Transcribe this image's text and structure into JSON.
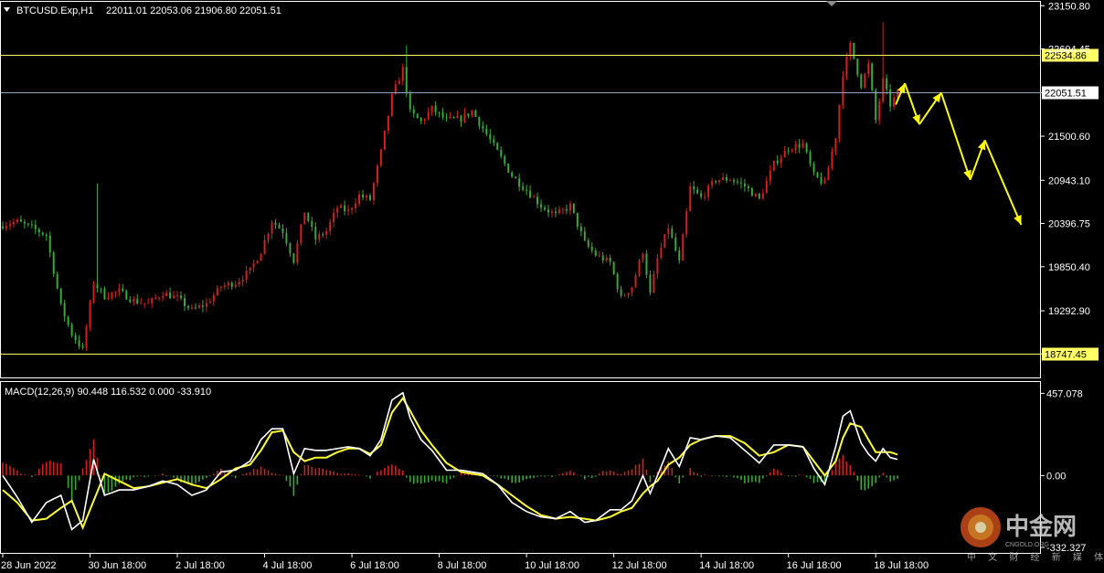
{
  "chart_header": {
    "symbol_text": "BTCUSD.Exp,H1",
    "ohlc_text": "22011.01 22053.06 21906.80 22051.51"
  },
  "macd_header": {
    "text": "MACD(12,26,9) 90.448 116.532 0.000 -33.910"
  },
  "watermark": {
    "brand": "中金网",
    "sub": "CNGOLD.ORG",
    "tagline": "中 文 财 经 新 媒 体"
  },
  "colors": {
    "background": "#000000",
    "frame": "#ffffff",
    "bull": "#d02020",
    "bear": "#3aa83a",
    "level_line": "#ffff66",
    "price_line": "#8fa3b8",
    "macd_line": "#ffffff",
    "signal_line": "#ffff33",
    "forecast": "#ffff00"
  },
  "chart_data": {
    "type": "candlestick",
    "price_axis": {
      "ylim": [
        18450,
        23200
      ],
      "ticks": [
        23150.8,
        22604.45,
        22051.51,
        21500.6,
        20943.1,
        20396.75,
        19850.4,
        19292.9,
        18747.45
      ],
      "tick_labels": [
        "23150.80",
        "22604.45",
        "22051.51",
        "21500.60",
        "20943.10",
        "20396.75",
        "19850.40",
        "19292.90",
        "18747.45"
      ],
      "tick_label_hidden": [
        "22604.45",
        "22051.51",
        "18747.45"
      ]
    },
    "x_axis": {
      "labels": [
        "28 Jun 2022",
        "30 Jun 18:00",
        "2 Jul 18:00",
        "4 Jul 18:00",
        "6 Jul 18:00",
        "8 Jul 18:00",
        "10 Jul 18:00",
        "12 Jul 18:00",
        "14 Jul 18:00",
        "16 Jul 18:00",
        "18 Jul 18:00"
      ],
      "label_bar_index": [
        0,
        24,
        48,
        72,
        96,
        120,
        144,
        168,
        192,
        216,
        240
      ]
    },
    "horizontal_levels": [
      {
        "value": 22534.86,
        "label": "22534.86",
        "kind": "level"
      },
      {
        "value": 22051.51,
        "label": "22051.51",
        "kind": "current"
      },
      {
        "value": 18747.45,
        "label": "18747.45",
        "kind": "level"
      }
    ],
    "close_path": [
      [
        0,
        20380
      ],
      [
        4,
        20420
      ],
      [
        8,
        20340
      ],
      [
        12,
        20250
      ],
      [
        16,
        19350
      ],
      [
        19,
        19000
      ],
      [
        22,
        18800
      ],
      [
        25,
        19650
      ],
      [
        28,
        19480
      ],
      [
        32,
        19540
      ],
      [
        36,
        19420
      ],
      [
        40,
        19380
      ],
      [
        44,
        19520
      ],
      [
        48,
        19450
      ],
      [
        52,
        19300
      ],
      [
        56,
        19380
      ],
      [
        60,
        19600
      ],
      [
        64,
        19650
      ],
      [
        68,
        19800
      ],
      [
        71,
        20050
      ],
      [
        74,
        20430
      ],
      [
        77,
        20300
      ],
      [
        80,
        19930
      ],
      [
        83,
        20550
      ],
      [
        86,
        20200
      ],
      [
        89,
        20300
      ],
      [
        92,
        20600
      ],
      [
        95,
        20550
      ],
      [
        98,
        20750
      ],
      [
        101,
        20700
      ],
      [
        104,
        21300
      ],
      [
        107,
        22000
      ],
      [
        110,
        22350
      ],
      [
        112,
        21800
      ],
      [
        115,
        21680
      ],
      [
        118,
        21850
      ],
      [
        122,
        21700
      ],
      [
        126,
        21720
      ],
      [
        129,
        21820
      ],
      [
        132,
        21600
      ],
      [
        136,
        21300
      ],
      [
        140,
        21000
      ],
      [
        144,
        20820
      ],
      [
        148,
        20620
      ],
      [
        152,
        20500
      ],
      [
        156,
        20620
      ],
      [
        160,
        20150
      ],
      [
        163,
        20000
      ],
      [
        167,
        19900
      ],
      [
        170,
        19450
      ],
      [
        173,
        19600
      ],
      [
        176,
        20050
      ],
      [
        178,
        19500
      ],
      [
        180,
        19950
      ],
      [
        183,
        20350
      ],
      [
        186,
        19900
      ],
      [
        189,
        20850
      ],
      [
        192,
        20720
      ],
      [
        196,
        20950
      ],
      [
        200,
        20960
      ],
      [
        204,
        20870
      ],
      [
        208,
        20700
      ],
      [
        212,
        21150
      ],
      [
        216,
        21350
      ],
      [
        220,
        21400
      ],
      [
        223,
        21000
      ],
      [
        226,
        20900
      ],
      [
        229,
        21500
      ],
      [
        231,
        22300
      ],
      [
        233,
        22650
      ],
      [
        236,
        22150
      ],
      [
        238,
        22400
      ],
      [
        240,
        21700
      ],
      [
        242,
        22200
      ],
      [
        244,
        21900
      ],
      [
        246,
        22051.51
      ]
    ],
    "bar_count": 247,
    "price_range": {
      "high": 22940,
      "low": 18800
    },
    "forecast_path": [
      [
        245.5,
        21900
      ],
      [
        248,
        22170
      ],
      [
        252,
        21650
      ],
      [
        258,
        22050
      ],
      [
        266,
        20950
      ],
      [
        270,
        21450
      ],
      [
        280,
        20380
      ]
    ],
    "macd": {
      "ylim": [
        -430,
        520
      ],
      "ticks": [
        457.078,
        0.0,
        -332.327
      ],
      "tick_labels": [
        "457.078",
        "0.00",
        "-332.327"
      ],
      "macd_path": [
        [
          0,
          0
        ],
        [
          4,
          -120
        ],
        [
          8,
          -260
        ],
        [
          12,
          -150
        ],
        [
          16,
          -110
        ],
        [
          19,
          -300
        ],
        [
          22,
          -250
        ],
        [
          25,
          90
        ],
        [
          28,
          -110
        ],
        [
          32,
          -80
        ],
        [
          36,
          -80
        ],
        [
          40,
          -60
        ],
        [
          44,
          -30
        ],
        [
          48,
          -50
        ],
        [
          52,
          -110
        ],
        [
          56,
          -80
        ],
        [
          60,
          20
        ],
        [
          64,
          30
        ],
        [
          68,
          80
        ],
        [
          71,
          200
        ],
        [
          74,
          260
        ],
        [
          77,
          260
        ],
        [
          80,
          10
        ],
        [
          83,
          150
        ],
        [
          86,
          140
        ],
        [
          89,
          140
        ],
        [
          92,
          150
        ],
        [
          95,
          160
        ],
        [
          98,
          150
        ],
        [
          101,
          110
        ],
        [
          104,
          200
        ],
        [
          107,
          420
        ],
        [
          110,
          460
        ],
        [
          112,
          320
        ],
        [
          115,
          200
        ],
        [
          118,
          140
        ],
        [
          122,
          30
        ],
        [
          126,
          30
        ],
        [
          129,
          20
        ],
        [
          132,
          10
        ],
        [
          136,
          -50
        ],
        [
          140,
          -150
        ],
        [
          144,
          -200
        ],
        [
          148,
          -230
        ],
        [
          152,
          -240
        ],
        [
          156,
          -200
        ],
        [
          160,
          -260
        ],
        [
          163,
          -250
        ],
        [
          167,
          -190
        ],
        [
          170,
          -190
        ],
        [
          173,
          -140
        ],
        [
          176,
          0
        ],
        [
          178,
          -100
        ],
        [
          180,
          0
        ],
        [
          183,
          150
        ],
        [
          186,
          50
        ],
        [
          189,
          210
        ],
        [
          192,
          200
        ],
        [
          196,
          220
        ],
        [
          200,
          210
        ],
        [
          204,
          140
        ],
        [
          208,
          70
        ],
        [
          212,
          170
        ],
        [
          216,
          170
        ],
        [
          220,
          160
        ],
        [
          223,
          40
        ],
        [
          226,
          -50
        ],
        [
          229,
          160
        ],
        [
          231,
          330
        ],
        [
          233,
          360
        ],
        [
          236,
          180
        ],
        [
          238,
          120
        ],
        [
          240,
          80
        ],
        [
          242,
          150
        ],
        [
          244,
          100
        ],
        [
          246,
          90
        ]
      ],
      "signal_path": [
        [
          0,
          -80
        ],
        [
          4,
          -150
        ],
        [
          8,
          -250
        ],
        [
          12,
          -240
        ],
        [
          16,
          -180
        ],
        [
          19,
          -140
        ],
        [
          22,
          -290
        ],
        [
          25,
          -140
        ],
        [
          28,
          10
        ],
        [
          32,
          -30
        ],
        [
          36,
          -70
        ],
        [
          40,
          -60
        ],
        [
          44,
          -40
        ],
        [
          48,
          -20
        ],
        [
          52,
          -50
        ],
        [
          56,
          -70
        ],
        [
          60,
          -20
        ],
        [
          64,
          40
        ],
        [
          68,
          60
        ],
        [
          71,
          140
        ],
        [
          74,
          240
        ],
        [
          77,
          250
        ],
        [
          80,
          130
        ],
        [
          83,
          80
        ],
        [
          86,
          100
        ],
        [
          89,
          100
        ],
        [
          92,
          130
        ],
        [
          95,
          150
        ],
        [
          98,
          150
        ],
        [
          101,
          120
        ],
        [
          104,
          170
        ],
        [
          107,
          350
        ],
        [
          110,
          430
        ],
        [
          112,
          360
        ],
        [
          115,
          250
        ],
        [
          118,
          170
        ],
        [
          122,
          70
        ],
        [
          126,
          20
        ],
        [
          129,
          10
        ],
        [
          132,
          0
        ],
        [
          136,
          -50
        ],
        [
          140,
          -110
        ],
        [
          144,
          -170
        ],
        [
          148,
          -220
        ],
        [
          152,
          -240
        ],
        [
          156,
          -230
        ],
        [
          160,
          -240
        ],
        [
          163,
          -250
        ],
        [
          167,
          -230
        ],
        [
          170,
          -200
        ],
        [
          173,
          -180
        ],
        [
          176,
          -100
        ],
        [
          178,
          -60
        ],
        [
          180,
          -30
        ],
        [
          183,
          60
        ],
        [
          186,
          100
        ],
        [
          189,
          170
        ],
        [
          192,
          200
        ],
        [
          196,
          220
        ],
        [
          200,
          220
        ],
        [
          204,
          180
        ],
        [
          208,
          110
        ],
        [
          212,
          130
        ],
        [
          216,
          170
        ],
        [
          220,
          160
        ],
        [
          223,
          80
        ],
        [
          226,
          0
        ],
        [
          229,
          80
        ],
        [
          231,
          210
        ],
        [
          233,
          290
        ],
        [
          236,
          270
        ],
        [
          238,
          200
        ],
        [
          240,
          130
        ],
        [
          242,
          130
        ],
        [
          244,
          130
        ],
        [
          246,
          116.532
        ]
      ]
    }
  }
}
